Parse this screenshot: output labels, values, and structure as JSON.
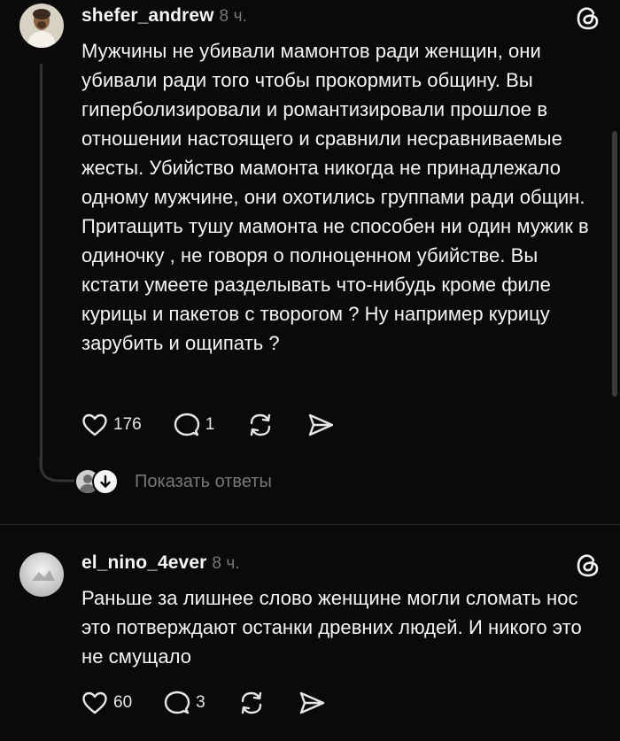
{
  "post1": {
    "username": "shefer_andrew",
    "time": "8 ч.",
    "text": "Мужчины не убивали мамонтов ради женщин, они убивали ради того чтобы прокормить общину. Вы гиперболизировали и романтизировали прошлое в отношении настоящего и сравнили несравниваемые жесты. Убийство мамонта никогда не принадлежало одному мужчине, они охотились группами ради общин. Притащить тушу мамонта не способен ни один мужик в одиночку , не говоря о полноценном убийстве.  Вы кстати умеете разделывать что-нибудь кроме филе курицы и пакетов с творогом ? Ну например курицу зарубить и ощипать ?",
    "likes": "176",
    "comments": "1",
    "show_replies": "Показать ответы"
  },
  "post2": {
    "username": "el_nino_4ever",
    "time": "8 ч.",
    "text": "Раньше за лишнее слово женщине могли сломать нос это потверждают останки древних людей. И никого это не смущало",
    "likes": "60",
    "comments": "3"
  },
  "icons": {
    "like": "heart-icon",
    "comment": "comment-bubble-icon",
    "repost": "repost-icon",
    "share": "send-icon",
    "threads": "threads-logo-icon"
  },
  "colors": {
    "background": "#0a0a0a",
    "text": "#f3f5f7",
    "muted": "#777777"
  }
}
